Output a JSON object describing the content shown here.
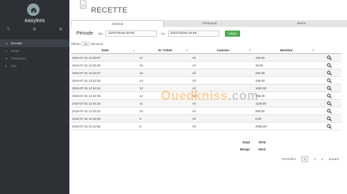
{
  "sidebar": {
    "brand": "easykes",
    "items": [
      {
        "label": "Recette",
        "icon": "home-icon",
        "active": true
      },
      {
        "label": "Stock",
        "icon": "box-icon",
        "active": false
      },
      {
        "label": "Personnel",
        "icon": "user-icon",
        "active": false
      },
      {
        "label": "Info",
        "icon": "info-icon",
        "active": false
      }
    ]
  },
  "header": {
    "title": "RECETTE"
  },
  "tabs": [
    {
      "label": "Général",
      "active": true
    },
    {
      "label": "Personnel",
      "active": false
    },
    {
      "label": "Heure",
      "active": false
    }
  ],
  "period": {
    "label": "Période",
    "from_label": "Du",
    "from_value": "31/07/2016 00:00",
    "to_label": "Au",
    "to_value": "31/07/2016 23:59",
    "validate_label": "Valider"
  },
  "afficher": {
    "prefix": "Afficher",
    "value": "10",
    "suffix": "éléments"
  },
  "table": {
    "columns": [
      "Date",
      "N° Ticket",
      "Caissier",
      "Montant"
    ],
    "rows": [
      {
        "date": "2016-07-31 16:26:07",
        "ticket": "17",
        "caissier": "Ali",
        "montant": "120.00"
      },
      {
        "date": "2016-07-31 16:25:28",
        "ticket": "16",
        "caissier": "Ali",
        "montant": "30.00"
      },
      {
        "date": "2016-07-31 13:43:27",
        "ticket": "15",
        "caissier": "Ali",
        "montant": "250.00"
      },
      {
        "date": "2016-07-31 13:22:30",
        "ticket": "14",
        "caissier": "Ali",
        "montant": "435.00"
      },
      {
        "date": "2016-07-31 12:54:24",
        "ticket": "13",
        "caissier": "Ali",
        "montant": "1000.00"
      },
      {
        "date": "2016-07-31 12:42:36",
        "ticket": "12",
        "caissier": "Ali",
        "montant": "745.00"
      },
      {
        "date": "2016-07-31 12:34:10",
        "ticket": "11",
        "caissier": "Ali",
        "montant": "1140.00"
      },
      {
        "date": "2016-07-31 12:33:44",
        "ticket": "10",
        "caissier": "Ali",
        "montant": "505.00"
      },
      {
        "date": "2016-07-31 12:28:46",
        "ticket": "9",
        "caissier": "Ali",
        "montant": "0.00"
      },
      {
        "date": "2016-07-31 12:12:50",
        "ticket": "8",
        "caissier": "Ali",
        "montant": "2095.00"
      }
    ]
  },
  "totals": {
    "total_label": "Total",
    "total_value": "7978",
    "marge_label": "Marge",
    "marge_value": "1614"
  },
  "pager": {
    "prev": "Précédent",
    "pages": [
      "1",
      "2",
      "3"
    ],
    "current": "1",
    "next": "Suivant"
  },
  "watermark": {
    "text": "Ouedkniss",
    "domain": ".com"
  },
  "colors": {
    "sidebar": "#2d3135",
    "accent_green": "#4cae4c",
    "watermark": "#ff961e"
  }
}
